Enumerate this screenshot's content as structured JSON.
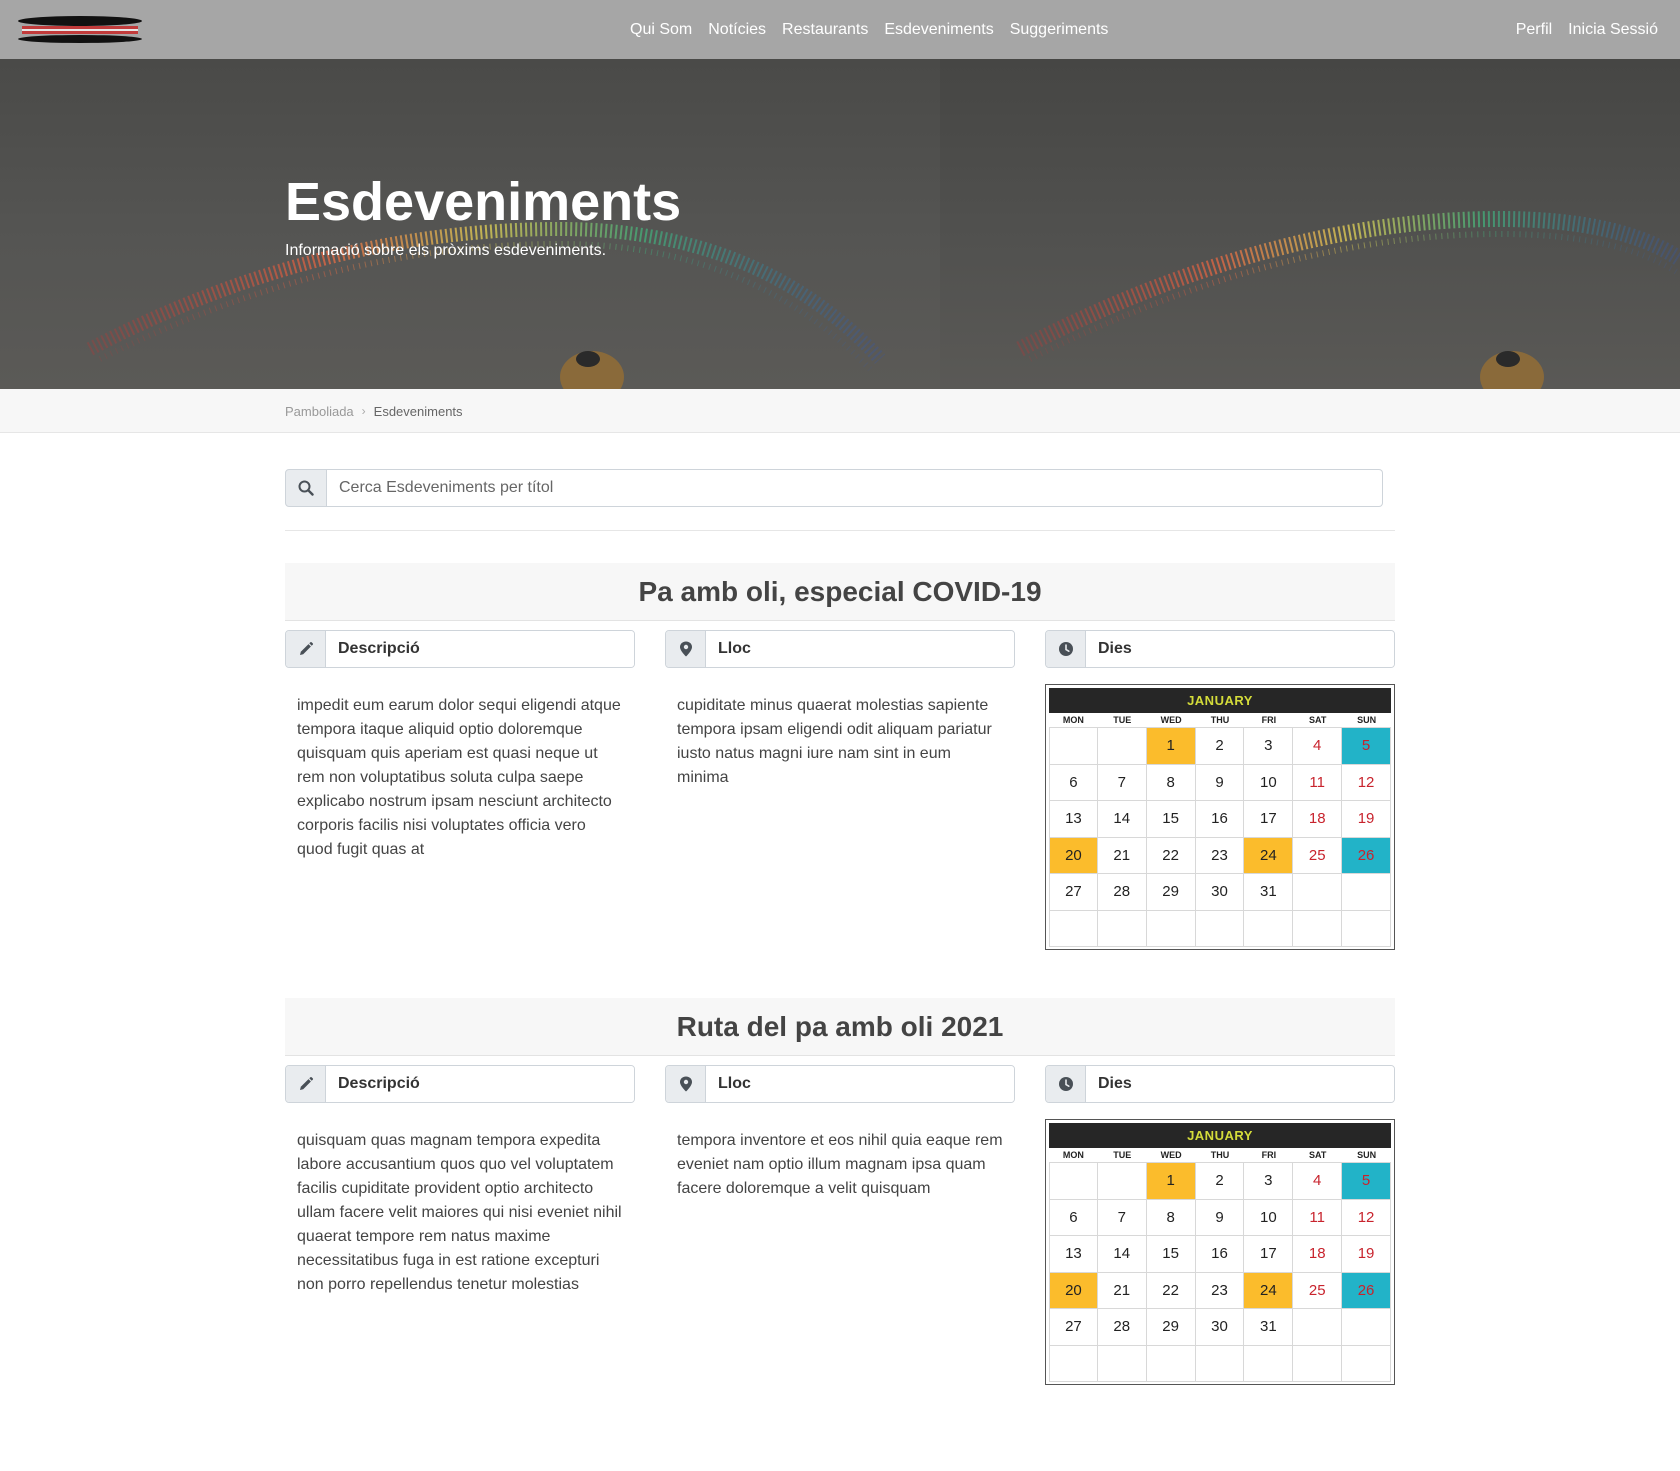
{
  "nav": {
    "links": [
      "Qui Som",
      "Notícies",
      "Restaurants",
      "Esdeveniments",
      "Suggeriments"
    ],
    "right": [
      "Perfil",
      "Inicia Sessió"
    ]
  },
  "hero": {
    "title": "Esdeveniments",
    "subtitle": "Informació sobre els pròxims esdeveniments."
  },
  "breadcrumb": {
    "home": "Pamboliada",
    "separator": "›",
    "current": "Esdeveniments"
  },
  "search": {
    "placeholder": "Cerca Esdeveniments per títol",
    "icon": "search-icon"
  },
  "events": [
    {
      "title": "Pa amb oli, especial COVID-19",
      "description_label": "Descripció",
      "description": "impedit eum earum dolor sequi eligendi atque tempora itaque aliquid optio doloremque quisquam quis aperiam est quasi neque ut rem non voluptatibus soluta culpa saepe explicabo nostrum ipsam nesciunt architecto corporis facilis nisi voluptates officia vero quod fugit quas at",
      "place_label": "Lloc",
      "place": "cupiditate minus quaerat molestias sapiente tempora ipsam eligendi odit aliquam pariatur iusto natus magni iure nam sint in eum minima",
      "days_label": "Dies"
    },
    {
      "title": "Ruta del pa amb oli 2021",
      "description_label": "Descripció",
      "description": "quisquam quas magnam tempora expedita labore accusantium quos quo vel voluptatem facilis cupiditate provident optio architecto ullam facere velit maiores qui nisi eveniet nihil quaerat tempore rem natus maxime necessitatibus fuga in est ratione excepturi non porro repellendus tenetur molestias",
      "place_label": "Lloc",
      "place": "tempora inventore et eos nihil quia eaque rem eveniet nam optio illum magnam ipsa quam facere doloremque a velit quisquam",
      "days_label": "Dies"
    }
  ],
  "calendar": {
    "month": "JANUARY",
    "weekdays": [
      "MON",
      "TUE",
      "WED",
      "THU",
      "FRI",
      "SAT",
      "SUN"
    ],
    "cells": [
      "",
      "",
      "1",
      "2",
      "3",
      "4",
      "5",
      "6",
      "7",
      "8",
      "9",
      "10",
      "11",
      "12",
      "13",
      "14",
      "15",
      "16",
      "17",
      "18",
      "19",
      "20",
      "21",
      "22",
      "23",
      "24",
      "25",
      "26",
      "27",
      "28",
      "29",
      "30",
      "31",
      "",
      "",
      "",
      "",
      "",
      "",
      "",
      "",
      ""
    ],
    "highlight_gold": [
      "1",
      "20",
      "24"
    ],
    "highlight_teal": [
      "5",
      "26"
    ],
    "colors": {
      "gold": "#fbbc2c",
      "teal": "#22b3c8",
      "weekend": "#c8232d",
      "header_bg": "#262626",
      "header_text": "#d4dc3a"
    }
  },
  "icons": {
    "description": "pencil-icon",
    "place": "map-marker-icon",
    "days": "clock-icon"
  }
}
